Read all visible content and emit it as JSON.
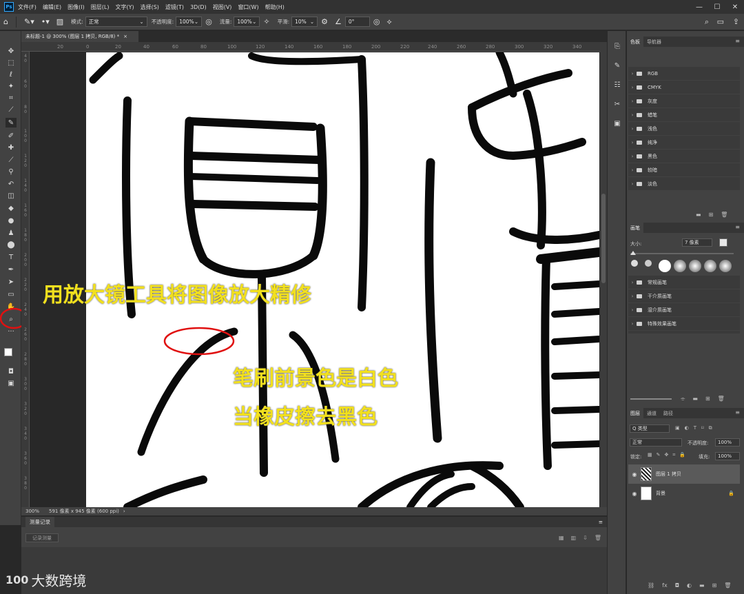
{
  "menubar": {
    "items": [
      "文件(F)",
      "编辑(E)",
      "图像(I)",
      "图层(L)",
      "文字(Y)",
      "选择(S)",
      "滤镜(T)",
      "3D(D)",
      "视图(V)",
      "窗口(W)",
      "帮助(H)"
    ],
    "window_buttons": [
      "—",
      "☐",
      "✕"
    ]
  },
  "options": {
    "mode_label": "模式:",
    "mode_value": "正常",
    "opacity_label": "不透明度:",
    "opacity_value": "100%",
    "flow_label": "流量:",
    "flow_value": "100%",
    "smoothing_label": "平滑:",
    "smoothing_value": "10%",
    "angle_value": "0°"
  },
  "document": {
    "tab_title": "未标题-1 @ 300% (图层 1 拷贝, RGB/8) *",
    "tab_close": "×",
    "zoom": "300%",
    "doc_info": "591 像素 x 945 像素 (600 ppi)"
  },
  "rulers": {
    "h_ticks": [
      "20",
      "0",
      "20",
      "40",
      "60",
      "80",
      "100",
      "120",
      "140",
      "160",
      "180",
      "200",
      "220",
      "240",
      "260",
      "280",
      "300",
      "320",
      "340"
    ],
    "v_ticks": [
      "4 0",
      "6 0",
      "8 0",
      "1 0 0",
      "1 2 0",
      "1 4 0",
      "1 6 0",
      "1 8 0",
      "2 0 0",
      "2 2 0",
      "2 4 0",
      "2 6 0",
      "2 8 0",
      "3 0 0",
      "3 2 0",
      "3 4 0",
      "3 6 0",
      "3 8 0"
    ]
  },
  "annotations": {
    "line1": "用放大镜工具将图像放大精修",
    "line2": "笔刷前景色是白色",
    "line3": "当橡皮擦去黑色"
  },
  "history_panel": {
    "tab": "测量记录",
    "record_button": "记录测量"
  },
  "watermark": {
    "logo_text": "100",
    "text": "大数跨境"
  },
  "swatches_panel": {
    "tabs": [
      "色板",
      "导航器"
    ],
    "colors": [
      "#ffffff",
      "#000000",
      "#1a1a1a",
      "#e00000",
      "#ffffff",
      "#ffff00",
      "#ffff00",
      "#ffe000",
      "#ffff00",
      "#ffd800",
      "#ffffff",
      "#ffffff"
    ],
    "groups": [
      "RGB",
      "CMYK",
      "灰度",
      "蜡笔",
      "浅色",
      "纯净",
      "黑色",
      "较暗",
      "淡色"
    ]
  },
  "brush_panel": {
    "tab": "画笔",
    "size_label": "大小:",
    "size_value": "7 像素",
    "groups": [
      "常规画笔",
      "干介质画笔",
      "湿介质画笔",
      "特殊效果画笔"
    ]
  },
  "layers_panel": {
    "tabs": [
      "图层",
      "通道",
      "路径"
    ],
    "filter_label": "Q 类型",
    "blend_mode": "正常",
    "opacity_label": "不透明度:",
    "opacity_value": "100%",
    "lock_label": "锁定:",
    "fill_label": "填充:",
    "fill_value": "100%",
    "layers": [
      {
        "name": "图层 1 拷贝",
        "selected": true
      },
      {
        "name": "背景",
        "selected": false
      }
    ]
  }
}
